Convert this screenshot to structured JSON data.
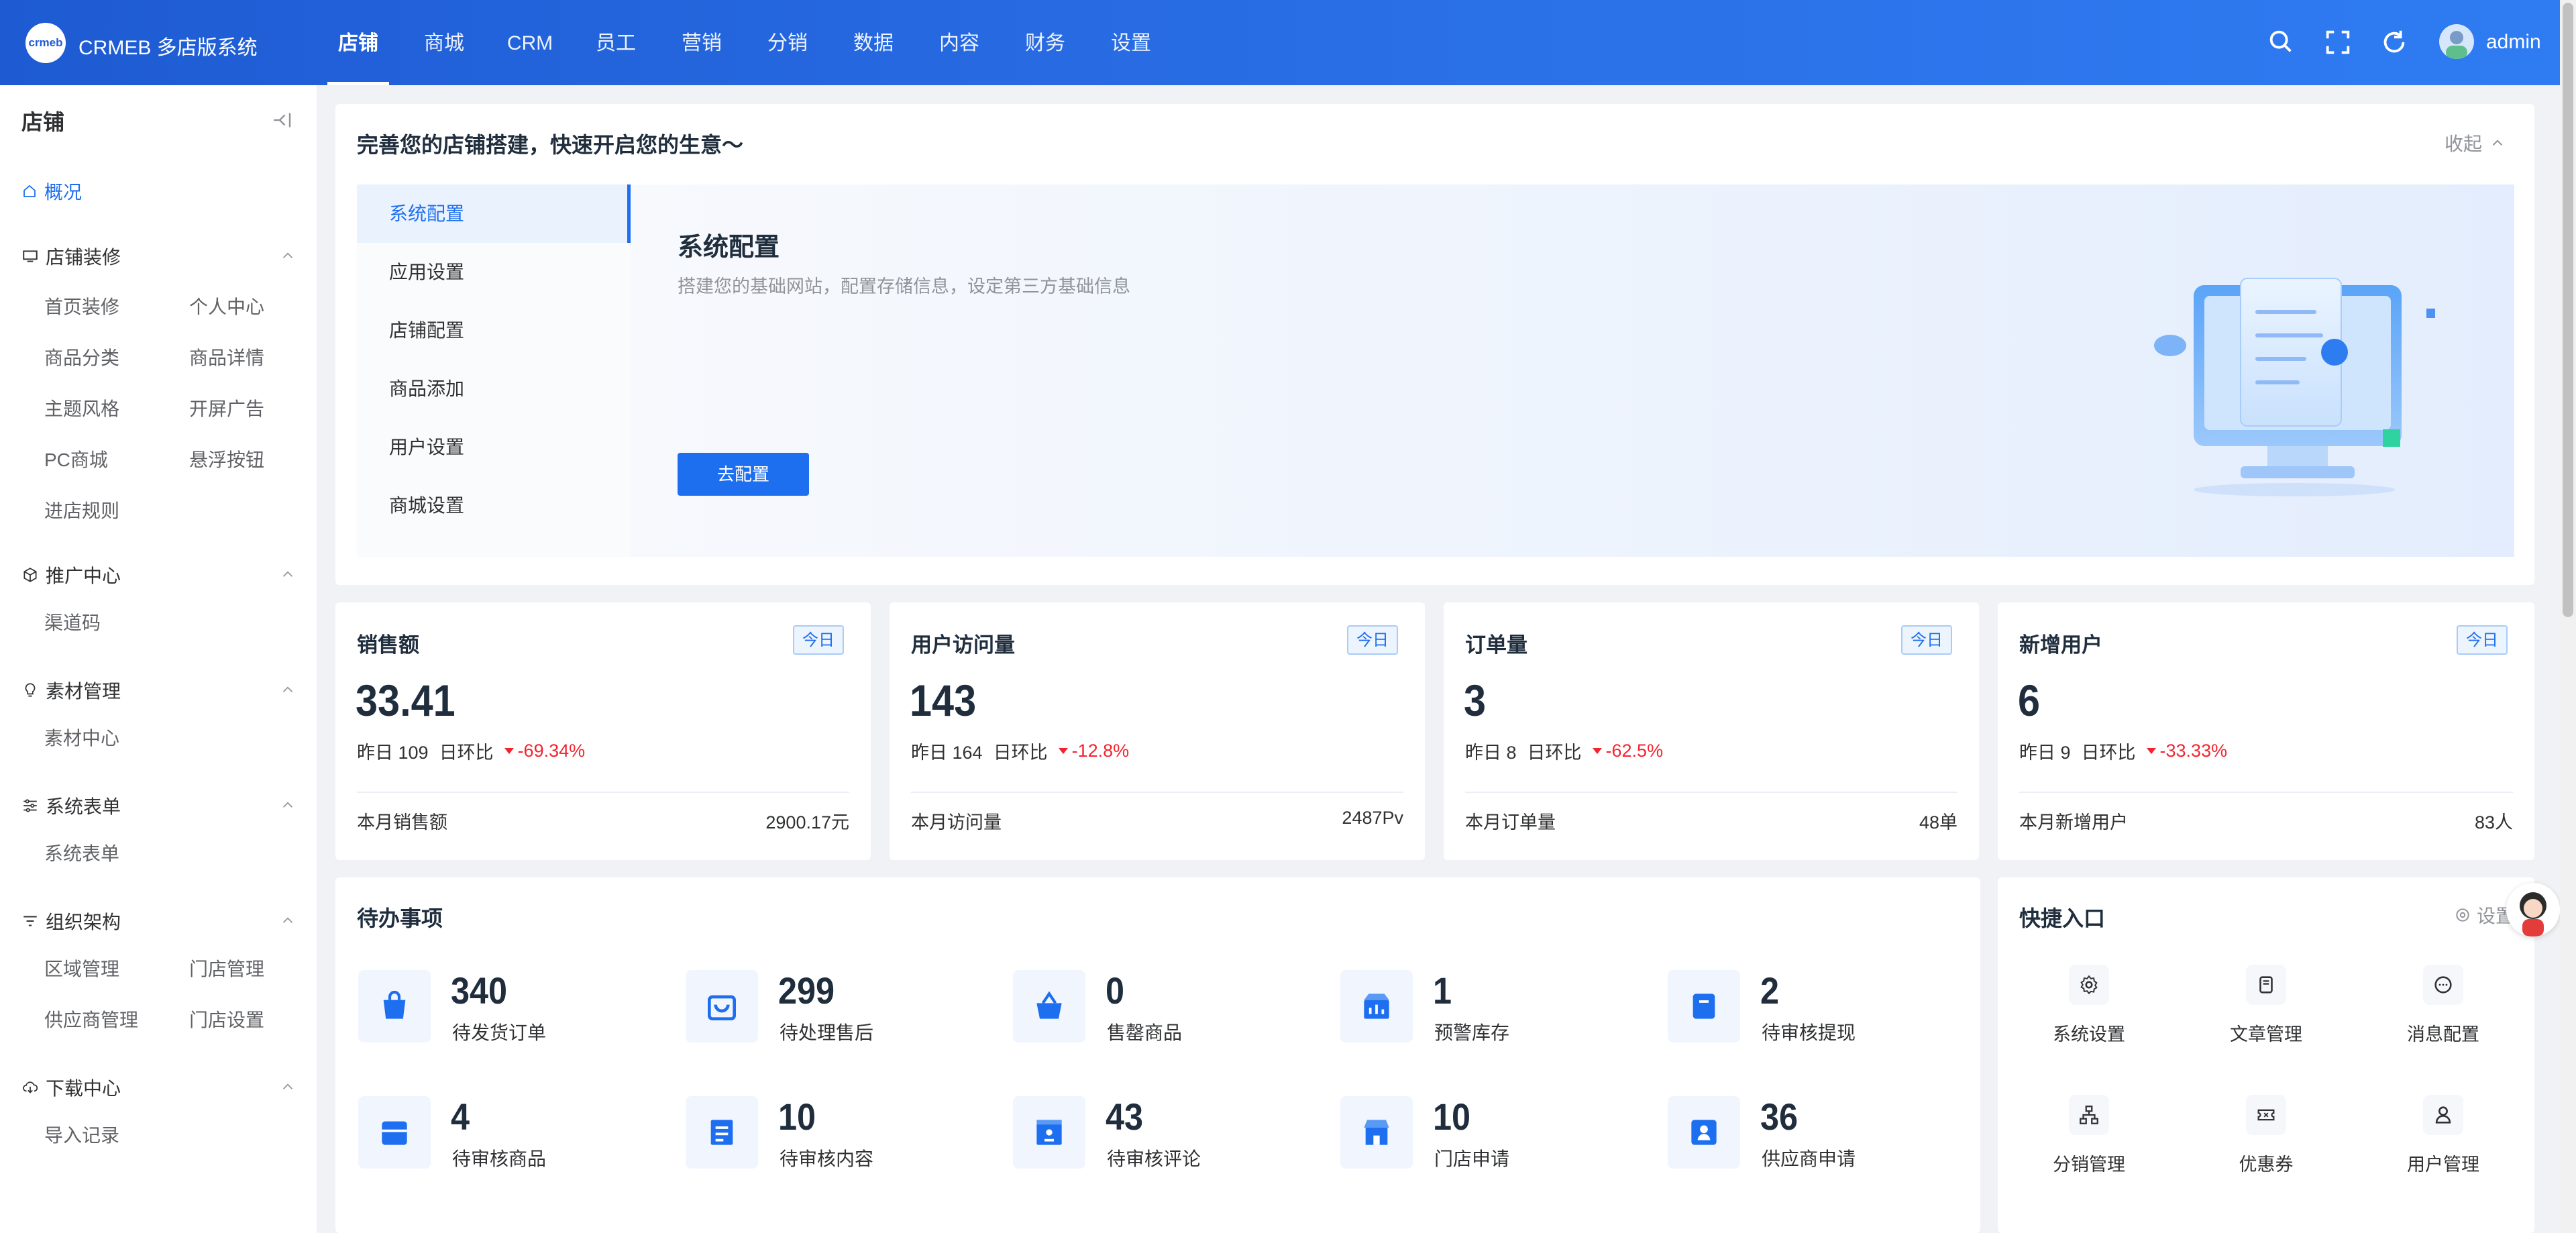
{
  "header": {
    "logo_text": "crmeb",
    "brand": "CRMEB 多店版系统",
    "nav": [
      "店铺",
      "商城",
      "CRM",
      "员工",
      "营销",
      "分销",
      "数据",
      "内容",
      "财务",
      "设置"
    ],
    "username": "admin"
  },
  "sidebar": {
    "title": "店铺",
    "overview": "概况",
    "groups": [
      {
        "name": "店铺装修",
        "items": [
          "首页装修",
          "个人中心",
          "商品分类",
          "商品详情",
          "主题风格",
          "开屏广告",
          "PC商城",
          "悬浮按钮",
          "进店规则"
        ]
      },
      {
        "name": "推广中心",
        "items": [
          "渠道码"
        ]
      },
      {
        "name": "素材管理",
        "items": [
          "素材中心"
        ]
      },
      {
        "name": "系统表单",
        "items": [
          "系统表单"
        ]
      },
      {
        "name": "组织架构",
        "items": [
          "区域管理",
          "门店管理",
          "供应商管理",
          "门店设置"
        ]
      },
      {
        "name": "下载中心",
        "items": [
          "导入记录"
        ]
      }
    ]
  },
  "setup": {
    "title": "完善您的店铺搭建，快速开启您的生意～",
    "fold_label": "收起",
    "menu": [
      "系统配置",
      "应用设置",
      "店铺配置",
      "商品添加",
      "用户设置",
      "商城设置"
    ],
    "panel_title": "系统配置",
    "panel_desc": "搭建您的基础网站，配置存储信息，设定第三方基础信息",
    "panel_button": "去配置"
  },
  "stats": [
    {
      "title": "销售额",
      "badge": "今日",
      "value": "33.41",
      "yesterday": "昨日 109",
      "ratio_label": "日环比",
      "ratio": "-69.34%",
      "month_label": "本月销售额",
      "month_value": "2900.17元"
    },
    {
      "title": "用户访问量",
      "badge": "今日",
      "value": "143",
      "yesterday": "昨日 164",
      "ratio_label": "日环比",
      "ratio": "-12.8%",
      "month_label": "本月访问量",
      "month_value": "2487Pv"
    },
    {
      "title": "订单量",
      "badge": "今日",
      "value": "3",
      "yesterday": "昨日 8",
      "ratio_label": "日环比",
      "ratio": "-62.5%",
      "month_label": "本月订单量",
      "month_value": "48单"
    },
    {
      "title": "新增用户",
      "badge": "今日",
      "value": "6",
      "yesterday": "昨日 9",
      "ratio_label": "日环比",
      "ratio": "-33.33%",
      "month_label": "本月新增用户",
      "month_value": "83人"
    }
  ],
  "todo": {
    "title": "待办事项",
    "items": [
      {
        "num": "340",
        "label": "待发货订单",
        "icon": "shopping-bag-icon"
      },
      {
        "num": "299",
        "label": "待处理售后",
        "icon": "cart-icon"
      },
      {
        "num": "0",
        "label": "售罄商品",
        "icon": "basket-icon"
      },
      {
        "num": "1",
        "label": "预警库存",
        "icon": "chart-box-icon"
      },
      {
        "num": "2",
        "label": "待审核提现",
        "icon": "wallet-icon"
      },
      {
        "num": "4",
        "label": "待审核商品",
        "icon": "store-icon"
      },
      {
        "num": "10",
        "label": "待审核内容",
        "icon": "document-icon"
      },
      {
        "num": "43",
        "label": "待审核评论",
        "icon": "comment-box-icon"
      },
      {
        "num": "10",
        "label": "门店申请",
        "icon": "shop-icon"
      },
      {
        "num": "36",
        "label": "供应商申请",
        "icon": "supplier-icon"
      }
    ]
  },
  "quick": {
    "title": "快捷入口",
    "setting_label": "设置",
    "items": [
      {
        "label": "系统设置",
        "icon": "gear-icon"
      },
      {
        "label": "文章管理",
        "icon": "article-icon"
      },
      {
        "label": "消息配置",
        "icon": "message-icon"
      },
      {
        "label": "分销管理",
        "icon": "distribution-icon"
      },
      {
        "label": "优惠券",
        "icon": "coupon-icon"
      },
      {
        "label": "用户管理",
        "icon": "user-icon"
      }
    ]
  },
  "colors": {
    "primary": "#1e6ff0",
    "header": "#2a6fe6",
    "down": "#f5222d"
  }
}
